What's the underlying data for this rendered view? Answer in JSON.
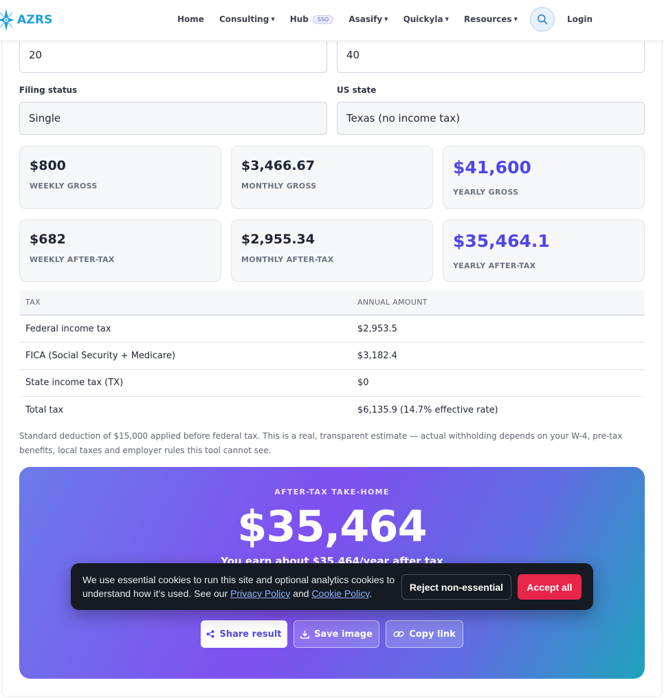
{
  "brand": {
    "name": "AZRS",
    "color": "#1aa0d8"
  },
  "nav": {
    "home": "Home",
    "consulting": "Consulting",
    "hub": "Hub",
    "hub_badge": "SSO",
    "asasify": "Asasify",
    "quickyla": "Quickyla",
    "resources": "Resources",
    "login": "Login"
  },
  "form": {
    "field_left_value": "20",
    "field_right_value": "40",
    "filing_status_label": "Filing status",
    "filing_status_value": "Single",
    "state_label": "US state",
    "state_value": "Texas (no income tax)"
  },
  "stats": {
    "weekly_gross": {
      "value": "$800",
      "label": "WEEKLY GROSS"
    },
    "monthly_gross": {
      "value": "$3,466.67",
      "label": "MONTHLY GROSS"
    },
    "yearly_gross": {
      "value": "$41,600",
      "label": "YEARLY GROSS"
    },
    "weekly_after": {
      "value": "$682",
      "label": "WEEKLY AFTER-TAX"
    },
    "monthly_after": {
      "value": "$2,955.34",
      "label": "MONTHLY AFTER-TAX"
    },
    "yearly_after": {
      "value": "$35,464.1",
      "label": "YEARLY AFTER-TAX"
    }
  },
  "table": {
    "headers": [
      "TAX",
      "ANNUAL AMOUNT"
    ],
    "rows": [
      [
        "Federal income tax",
        "$2,953.5"
      ],
      [
        "FICA (Social Security + Medicare)",
        "$3,182.4"
      ],
      [
        "State income tax (TX)",
        "$0"
      ],
      [
        "Total tax",
        "$6,135.9 (14.7% effective rate)"
      ]
    ]
  },
  "note": "Standard deduction of $15,000 applied before federal tax. This is a real, transparent estimate — actual withholding depends on your W-4, pre-tax benefits, local taxes and employer rules this tool cannot see.",
  "hero": {
    "kicker": "AFTER-TAX TAKE-HOME",
    "amount": "$35,464",
    "subtitle": "You earn about $35,464/year after tax",
    "share": "Share result",
    "save": "Save image",
    "copy": "Copy link"
  },
  "cookie": {
    "text_before": "We use essential cookies to run this site and optional analytics cookies to understand how it's used. See our ",
    "privacy_link": "Privacy Policy",
    "and": " and ",
    "cookie_link": "Cookie Policy",
    "period": ".",
    "reject": "Reject non-essential",
    "accept": "Accept all"
  },
  "colors": {
    "accent": "#4f46e5",
    "accept": "#e8264a",
    "cookie_bg": "#161a22"
  }
}
